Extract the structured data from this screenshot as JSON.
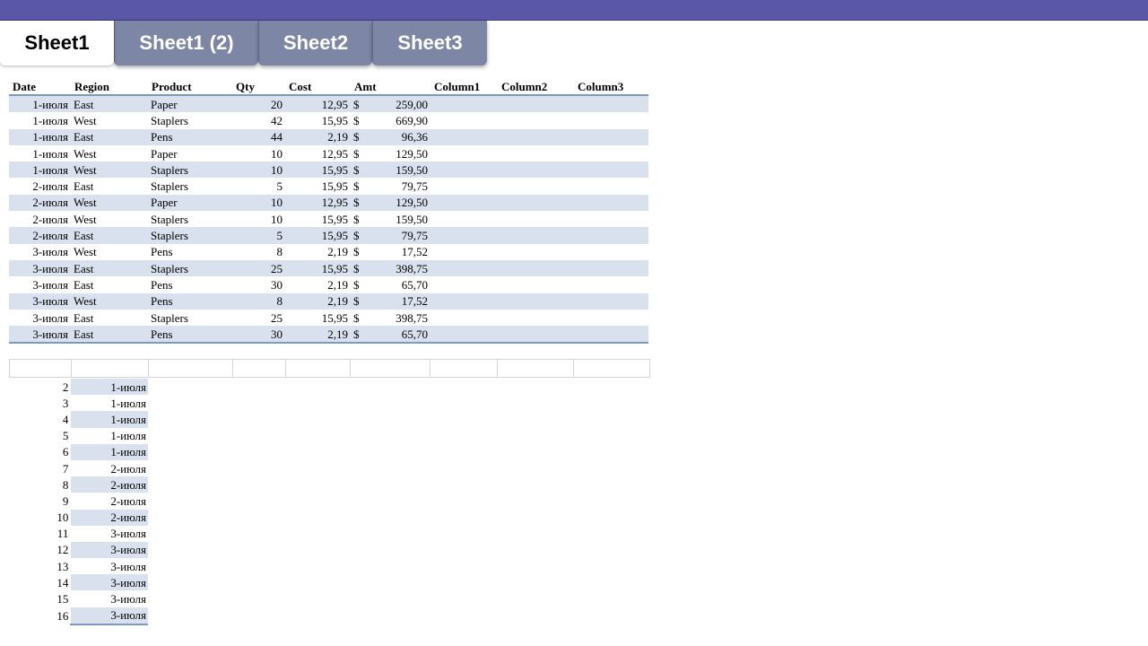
{
  "tabs": [
    "Sheet1",
    "Sheet1 (2)",
    "Sheet2",
    "Sheet3"
  ],
  "table": {
    "headers": [
      "Date",
      "Region",
      "Product",
      "Qty",
      "Cost",
      "Amt",
      "Column1",
      "Column2",
      "Column3"
    ],
    "rows": [
      [
        "1-июля",
        "East",
        "Paper",
        "20",
        "12,95",
        "$",
        "259,00"
      ],
      [
        "1-июля",
        "West",
        "Staplers",
        "42",
        "15,95",
        "$",
        "669,90"
      ],
      [
        "1-июля",
        "East",
        "Pens",
        "44",
        "2,19",
        "$",
        "96,36"
      ],
      [
        "1-июля",
        "West",
        "Paper",
        "10",
        "12,95",
        "$",
        "129,50"
      ],
      [
        "1-июля",
        "West",
        "Staplers",
        "10",
        "15,95",
        "$",
        "159,50"
      ],
      [
        "2-июля",
        "East",
        "Staplers",
        "5",
        "15,95",
        "$",
        "79,75"
      ],
      [
        "2-июля",
        "West",
        "Paper",
        "10",
        "12,95",
        "$",
        "129,50"
      ],
      [
        "2-июля",
        "West",
        "Staplers",
        "10",
        "15,95",
        "$",
        "159,50"
      ],
      [
        "2-июля",
        "East",
        "Staplers",
        "5",
        "15,95",
        "$",
        "79,75"
      ],
      [
        "3-июля",
        "West",
        "Pens",
        "8",
        "2,19",
        "$",
        "17,52"
      ],
      [
        "3-июля",
        "East",
        "Staplers",
        "25",
        "15,95",
        "$",
        "398,75"
      ],
      [
        "3-июля",
        "East",
        "Pens",
        "30",
        "2,19",
        "$",
        "65,70"
      ],
      [
        "3-июля",
        "West",
        "Pens",
        "8",
        "2,19",
        "$",
        "17,52"
      ],
      [
        "3-июля",
        "East",
        "Staplers",
        "25",
        "15,95",
        "$",
        "398,75"
      ],
      [
        "3-июля",
        "East",
        "Pens",
        "30",
        "2,19",
        "$",
        "65,70"
      ]
    ]
  },
  "lower": {
    "rows": [
      [
        "2",
        "1-июля"
      ],
      [
        "3",
        "1-июля"
      ],
      [
        "4",
        "1-июля"
      ],
      [
        "5",
        "1-июля"
      ],
      [
        "6",
        "1-июля"
      ],
      [
        "7",
        "2-июля"
      ],
      [
        "8",
        "2-июля"
      ],
      [
        "9",
        "2-июля"
      ],
      [
        "10",
        "2-июля"
      ],
      [
        "11",
        "3-июля"
      ],
      [
        "12",
        "3-июля"
      ],
      [
        "13",
        "3-июля"
      ],
      [
        "14",
        "3-июля"
      ],
      [
        "15",
        "3-июля"
      ],
      [
        "16",
        "3-июля"
      ]
    ]
  },
  "colors": {
    "topbar": "#5b57a8",
    "tab_inactive": "#7d87a5",
    "row_band": "#d9e1ee",
    "rule": "#7e98c2"
  }
}
